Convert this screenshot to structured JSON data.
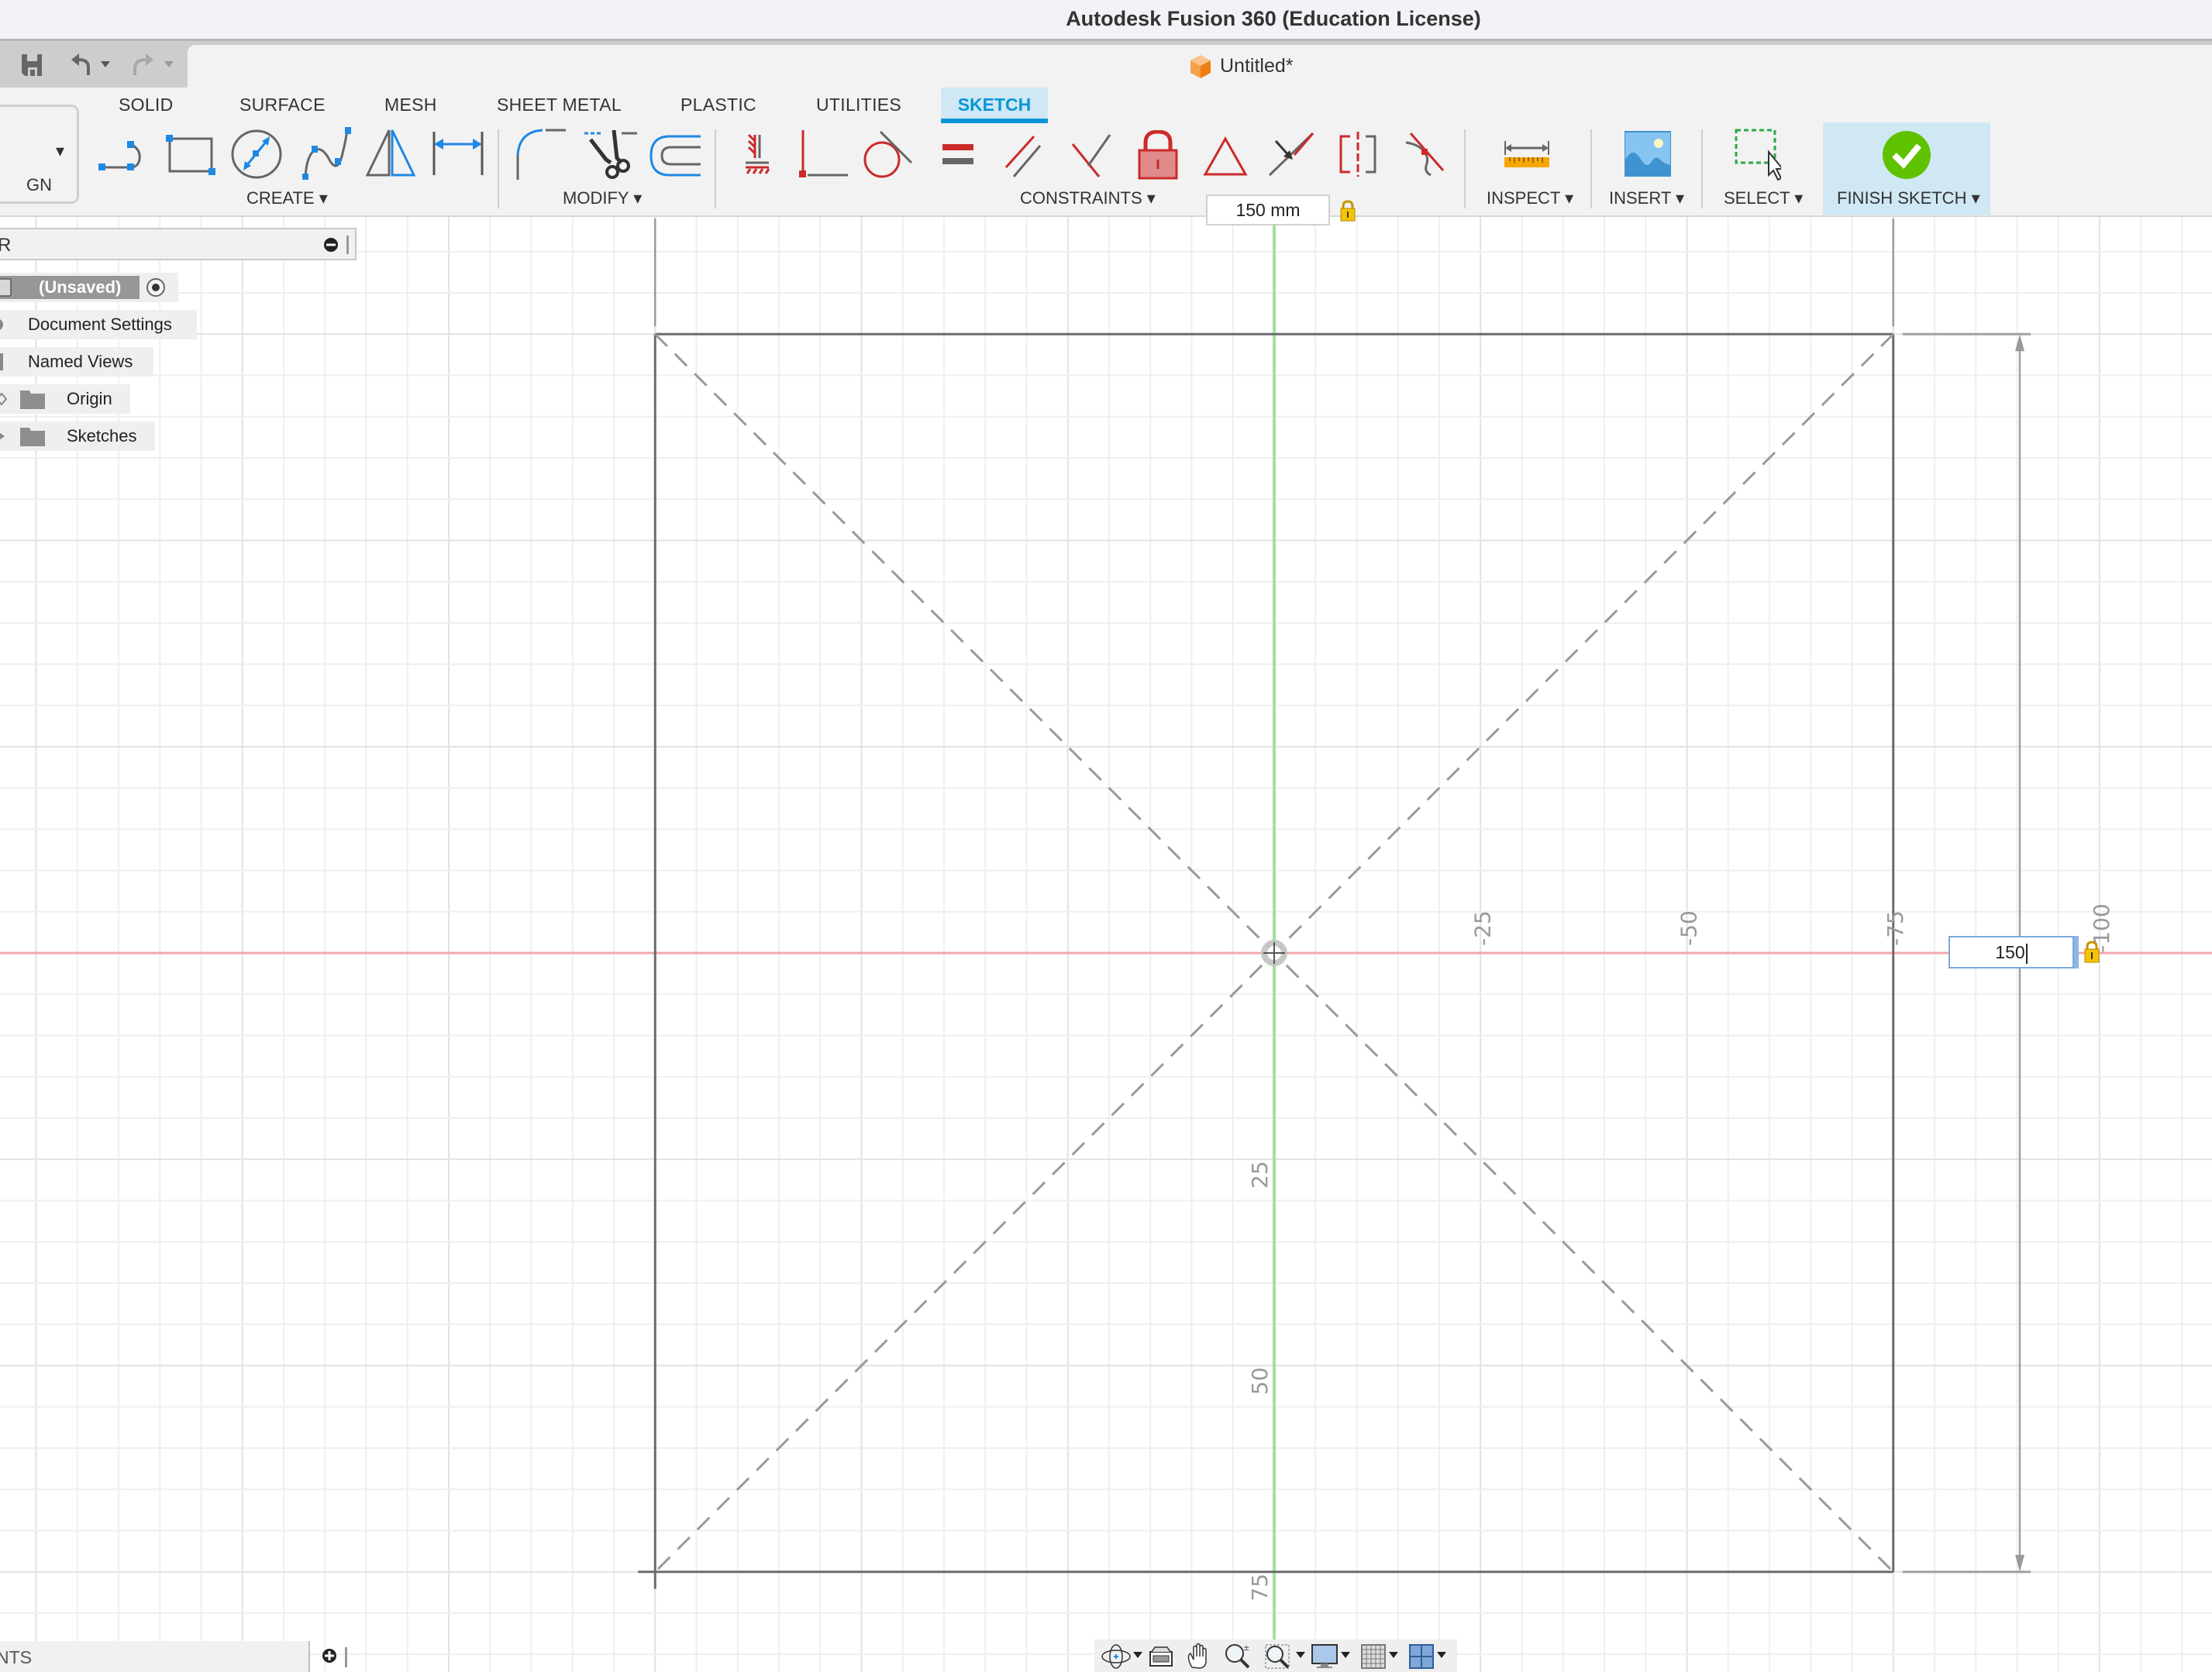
{
  "window": {
    "title": "Autodesk Fusion 360 (Education License)"
  },
  "quick_access": {
    "save_icon": "save-icon",
    "undo_icon": "undo-icon",
    "redo_icon": "redo-icon"
  },
  "document_tab": {
    "title": "Untitled*",
    "icon": "cube-icon"
  },
  "workspace": {
    "label": "GN"
  },
  "ribbon": {
    "tabs": [
      {
        "label": "SOLID",
        "active": false
      },
      {
        "label": "SURFACE",
        "active": false
      },
      {
        "label": "MESH",
        "active": false
      },
      {
        "label": "SHEET METAL",
        "active": false
      },
      {
        "label": "PLASTIC",
        "active": false
      },
      {
        "label": "UTILITIES",
        "active": false
      },
      {
        "label": "SKETCH",
        "active": true
      }
    ],
    "groups": [
      {
        "label": "CREATE ▾",
        "tools": [
          "line-icon",
          "rectangle-icon",
          "circle-icon",
          "spline-icon",
          "mirror-icon",
          "dimension-icon"
        ]
      },
      {
        "label": "MODIFY ▾",
        "tools": [
          "fillet-icon",
          "trim-icon",
          "offset-icon"
        ]
      },
      {
        "label": "CONSTRAINTS ▾",
        "tools": [
          "fix-icon",
          "coincident-icon",
          "tangent-icon",
          "equal-icon",
          "parallel-icon",
          "perpendicular-icon",
          "lock-icon",
          "horizontal-vertical-icon",
          "midpoint-icon",
          "symmetry-icon",
          "curvature-icon"
        ]
      },
      {
        "label": "INSPECT ▾",
        "tools": [
          "measure-icon"
        ]
      },
      {
        "label": "INSERT ▾",
        "tools": [
          "insert-image-icon"
        ]
      },
      {
        "label": "SELECT ▾",
        "tools": [
          "select-window-icon"
        ]
      },
      {
        "label": "FINISH SKETCH ▾",
        "tools": [
          "finish-sketch-check-icon"
        ]
      }
    ]
  },
  "browser": {
    "header_label": "R",
    "items": [
      {
        "label": "(Unsaved)",
        "type": "component"
      },
      {
        "label": "Document Settings",
        "type": "settings"
      },
      {
        "label": "Named Views",
        "type": "views"
      },
      {
        "label": "Origin",
        "type": "folder"
      },
      {
        "label": "Sketches",
        "type": "folder"
      }
    ]
  },
  "comments": {
    "label": "NTS"
  },
  "sketch": {
    "units": "mm",
    "rectangle": {
      "width": 150,
      "height": 150,
      "center": [
        0,
        0
      ]
    },
    "construction_diagonals": true,
    "dimension_horizontal": {
      "value": "150 mm",
      "locked": true
    },
    "dimension_vertical_input": {
      "value": "150",
      "locked": true
    },
    "x_axis_labels": [
      "-25",
      "-50",
      "-75",
      "-100"
    ],
    "y_axis_labels": [
      "25",
      "50",
      "75"
    ],
    "colors": {
      "x_axis": "#f2a7ab",
      "y_axis": "#9fe29f",
      "sketch_line": "#6b6b6b",
      "accent": "#0696d7"
    }
  },
  "nav_bar": {
    "tools": [
      "orbit-icon",
      "look-at-icon",
      "pan-icon",
      "zoom-icon",
      "zoom-window-icon",
      "display-settings-icon",
      "grid-settings-icon",
      "viewports-icon"
    ]
  }
}
